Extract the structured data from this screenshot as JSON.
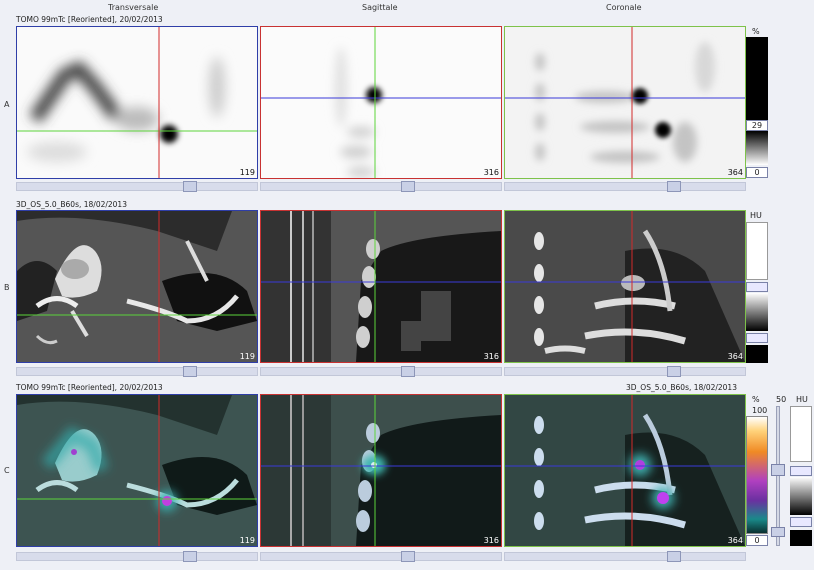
{
  "columns": {
    "transverse": "Transversale",
    "sagittal": "Sagittale",
    "coronal": "Coronale"
  },
  "rows": {
    "a": {
      "label": "A",
      "series": "TOMO 99mTc [Reoriented], 20/02/2013"
    },
    "b": {
      "label": "B",
      "series": "3D_OS_5.0_B60s, 18/02/2013"
    },
    "c": {
      "label": "C",
      "series_left": "TOMO 99mTc [Reoriented], 20/02/2013",
      "series_right": "3D_OS_5.0_B60s, 18/02/2013"
    }
  },
  "slices": {
    "transverse": "119",
    "sagittal": "316",
    "coronal": "364"
  },
  "scales": {
    "a": {
      "unit": "%",
      "level": "29",
      "min": "0"
    },
    "b": {
      "unit": "HU"
    },
    "c": {
      "unit_pct": "%",
      "max": "100",
      "min": "0",
      "blend": "50",
      "unit_hu": "HU"
    }
  },
  "colors": {
    "transverse_border": "#2f3ea8",
    "sagittal_border": "#c83232",
    "coronal_border": "#7ec24a",
    "crosshair_h_green": "#5cd43a",
    "crosshair_v_red": "#d22a2a",
    "crosshair_h_blue": "#3a3ad8"
  }
}
